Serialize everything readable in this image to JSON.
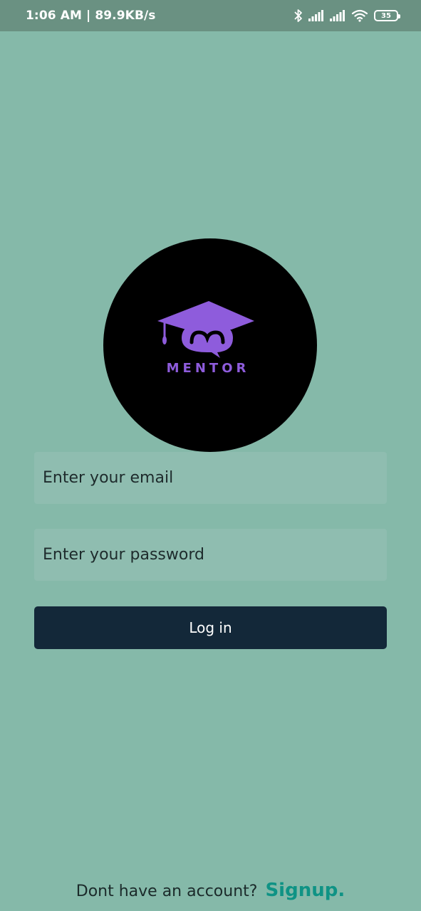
{
  "status_bar": {
    "time_speed": "1:06 AM | 89.9KB/s",
    "battery_level": "35",
    "icons": [
      "bluetooth-icon",
      "signal-icon",
      "signal-icon",
      "wifi-icon",
      "battery-icon"
    ]
  },
  "logo": {
    "text": "MENTOR",
    "icon": "graduation-cap-chat-icon",
    "color": "#8e5cdc"
  },
  "form": {
    "email_placeholder": "Enter your email",
    "email_value": "",
    "password_placeholder": "Enter your password",
    "password_value": "",
    "login_label": "Log in"
  },
  "footer": {
    "prompt": "Dont have an account?",
    "signup_label": "Signup."
  },
  "colors": {
    "background": "#85b9a9",
    "status_bar": "#6a9182",
    "field_background": "#8fbdb0",
    "button": "#132839",
    "signup": "#0f9385"
  }
}
